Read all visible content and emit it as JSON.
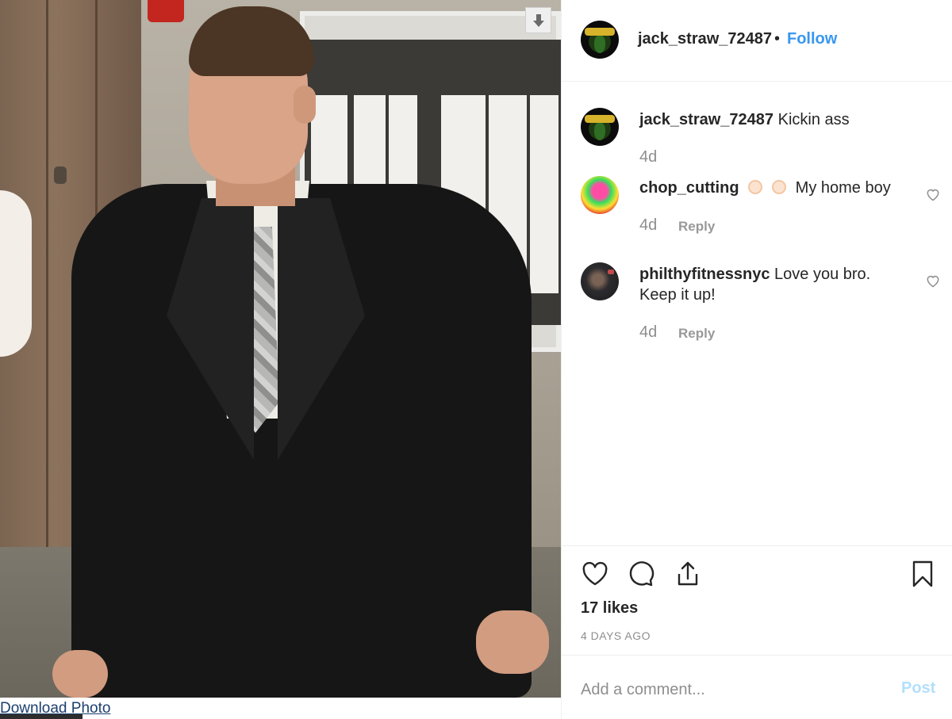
{
  "post": {
    "author": "jack_straw_72487",
    "separator": "•",
    "follow_label": "Follow"
  },
  "caption": {
    "user": "jack_straw_72487",
    "text": "Kickin ass",
    "age": "4d"
  },
  "comments": [
    {
      "user": "chop_cutting",
      "emoji_count": 2,
      "text": "My home boy",
      "age": "4d",
      "reply_label": "Reply"
    },
    {
      "user": "philthyfitnessnyc",
      "text": "Love you bro. Keep it up!",
      "age": "4d",
      "reply_label": "Reply"
    }
  ],
  "actions": {
    "icons": [
      "heart-icon",
      "comment-icon",
      "share-icon",
      "bookmark-icon"
    ],
    "likes": "17 likes",
    "time_ago": "4 DAYS AGO"
  },
  "comment_box": {
    "placeholder": "Add a comment...",
    "post_label": "Post"
  },
  "photo_overlay": {
    "download_label": "Download Photo"
  },
  "colors": {
    "link": "#3897f0",
    "muted": "#8e8e8e",
    "post_disabled": "#b2dffc",
    "text": "#262626"
  }
}
